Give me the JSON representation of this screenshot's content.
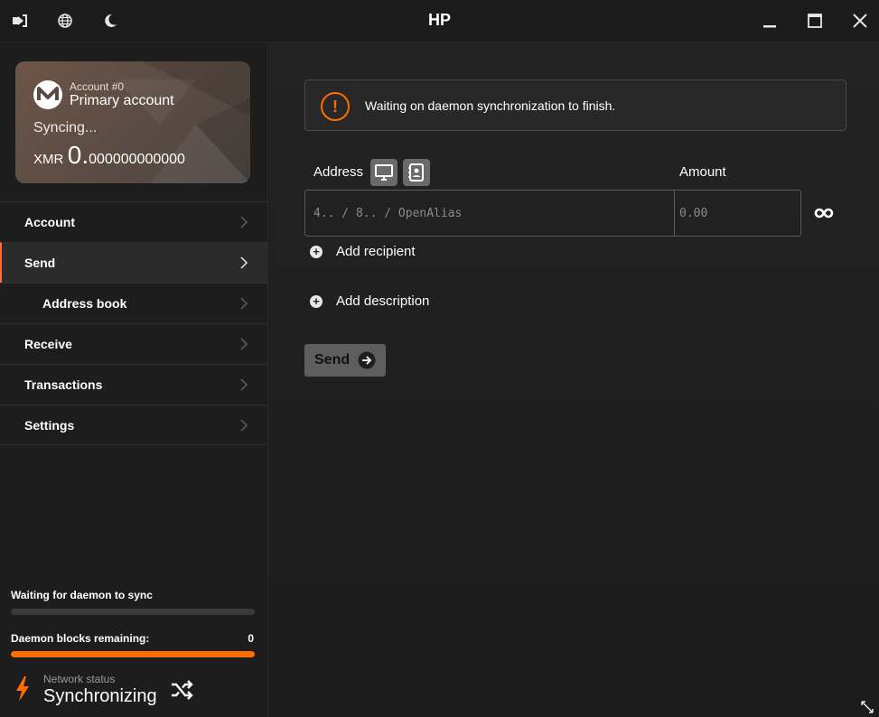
{
  "window": {
    "title": "HP",
    "icons": [
      "logout-icon",
      "globe-icon",
      "moon-icon",
      "minimize-icon",
      "maximize-icon",
      "close-icon"
    ]
  },
  "account_card": {
    "account_number": "Account #0",
    "account_name": "Primary account",
    "sync_status": "Syncing...",
    "currency": "XMR",
    "balance_int": "0.",
    "balance_dec": "000000000000",
    "logo": "monero-logo"
  },
  "nav": {
    "items": [
      {
        "label": "Account"
      },
      {
        "label": "Send"
      },
      {
        "label": "Address book"
      },
      {
        "label": "Receive"
      },
      {
        "label": "Transactions"
      },
      {
        "label": "Settings"
      }
    ],
    "active": "Send"
  },
  "sync": {
    "wallet_label": "Waiting for daemon to sync",
    "wallet_progress": 0,
    "daemon_label": "Daemon blocks remaining:",
    "daemon_value": "0",
    "daemon_progress": 1.0
  },
  "network": {
    "label": "Network status",
    "status": "Synchronizing"
  },
  "send": {
    "warning": "Waiting on daemon synchronization to finish.",
    "address_label": "Address",
    "amount_label": "Amount",
    "address_placeholder": "4.. / 8.. / OpenAlias",
    "amount_placeholder": "0.00",
    "add_recipient": "Add recipient",
    "add_description": "Add description",
    "send_button": "Send"
  },
  "colors": {
    "accent": "#ff6c00",
    "background": "#1c1c1c",
    "sidebar": "#1d1d1d"
  }
}
